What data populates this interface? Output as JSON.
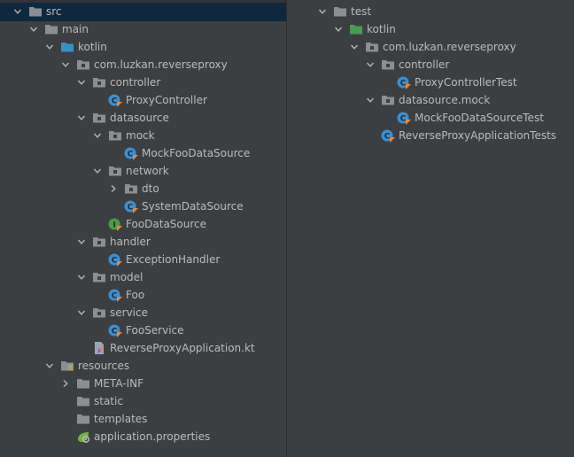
{
  "colors": {
    "pane_bg": "#3c3f41",
    "selection_bg": "#0d293e",
    "text": "#bbbbbb",
    "folder": "#8a8f93",
    "source_folder": "#3592c4",
    "test_folder": "#499c54",
    "class_blue": "#3d8fcf",
    "class_green": "#4d9b47",
    "kotlin_orange": "#e8883a"
  },
  "main_tree": {
    "items": [
      {
        "label": "src",
        "icon": "folder-icon"
      },
      {
        "label": "main",
        "icon": "folder-icon"
      },
      {
        "label": "kotlin",
        "icon": "source-folder-icon"
      },
      {
        "label": "com.luzkan.reverseproxy",
        "icon": "package-icon"
      },
      {
        "label": "controller",
        "icon": "package-icon"
      },
      {
        "label": "ProxyController",
        "icon": "kotlin-class-icon"
      },
      {
        "label": "datasource",
        "icon": "package-icon"
      },
      {
        "label": "mock",
        "icon": "package-icon"
      },
      {
        "label": "MockFooDataSource",
        "icon": "kotlin-class-icon"
      },
      {
        "label": "network",
        "icon": "package-icon"
      },
      {
        "label": "dto",
        "icon": "package-icon"
      },
      {
        "label": "SystemDataSource",
        "icon": "kotlin-class-icon"
      },
      {
        "label": "FooDataSource",
        "icon": "kotlin-interface-icon"
      },
      {
        "label": "handler",
        "icon": "package-icon"
      },
      {
        "label": "ExceptionHandler",
        "icon": "kotlin-class-icon"
      },
      {
        "label": "model",
        "icon": "package-icon"
      },
      {
        "label": "Foo",
        "icon": "kotlin-class-icon"
      },
      {
        "label": "service",
        "icon": "package-icon"
      },
      {
        "label": "FooService",
        "icon": "kotlin-class-icon"
      },
      {
        "label": "ReverseProxyApplication.kt",
        "icon": "kotlin-file-icon"
      },
      {
        "label": "resources",
        "icon": "resources-folder-icon"
      },
      {
        "label": "META-INF",
        "icon": "folder-icon"
      },
      {
        "label": "static",
        "icon": "folder-icon"
      },
      {
        "label": "templates",
        "icon": "folder-icon"
      },
      {
        "label": "application.properties",
        "icon": "properties-file-icon"
      }
    ]
  },
  "test_tree": {
    "items": [
      {
        "label": "test",
        "icon": "folder-icon"
      },
      {
        "label": "kotlin",
        "icon": "test-source-folder-icon"
      },
      {
        "label": "com.luzkan.reverseproxy",
        "icon": "package-icon"
      },
      {
        "label": "controller",
        "icon": "package-icon"
      },
      {
        "label": "ProxyControllerTest",
        "icon": "kotlin-class-icon"
      },
      {
        "label": "datasource.mock",
        "icon": "package-icon"
      },
      {
        "label": "MockFooDataSourceTest",
        "icon": "kotlin-class-icon"
      },
      {
        "label": "ReverseProxyApplicationTests",
        "icon": "kotlin-class-icon"
      }
    ]
  }
}
